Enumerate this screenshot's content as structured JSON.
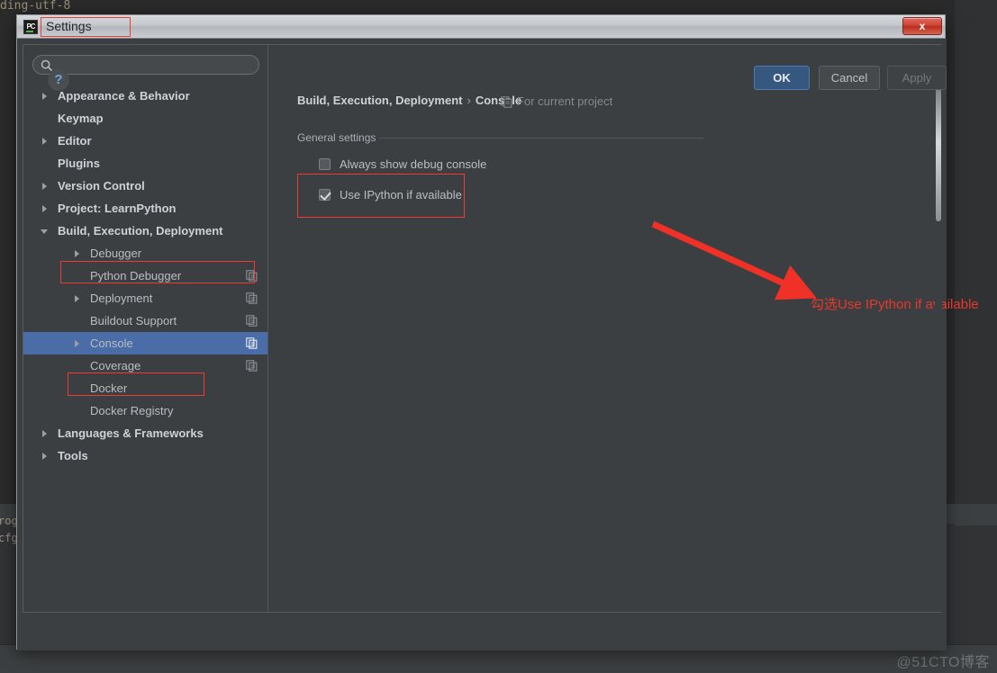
{
  "window": {
    "title": "Settings",
    "app_icon": "pycharm-icon",
    "close_label": "x"
  },
  "background": {
    "code_fragments": [
      "ding-utf-8",
      "rog",
      "cfg"
    ],
    "watermark": "@51CTO博客"
  },
  "sidebar": {
    "search": {
      "value": "",
      "placeholder": "",
      "icon": "search-icon"
    },
    "items": [
      {
        "label": "Appearance & Behavior",
        "level": 0,
        "arrow": "collapsed",
        "scope_icon": false,
        "selected": false
      },
      {
        "label": "Keymap",
        "level": 0,
        "arrow": "none",
        "scope_icon": false,
        "selected": false
      },
      {
        "label": "Editor",
        "level": 0,
        "arrow": "collapsed",
        "scope_icon": false,
        "selected": false
      },
      {
        "label": "Plugins",
        "level": 0,
        "arrow": "none",
        "scope_icon": false,
        "selected": false
      },
      {
        "label": "Version Control",
        "level": 0,
        "arrow": "collapsed",
        "scope_icon": false,
        "selected": false
      },
      {
        "label": "Project: LearnPython",
        "level": 0,
        "arrow": "collapsed",
        "scope_icon": false,
        "selected": false
      },
      {
        "label": "Build, Execution, Deployment",
        "level": 0,
        "arrow": "expanded",
        "scope_icon": false,
        "selected": false
      },
      {
        "label": "Debugger",
        "level": 1,
        "arrow": "collapsed",
        "scope_icon": false,
        "selected": false
      },
      {
        "label": "Python Debugger",
        "level": 1,
        "arrow": "none",
        "scope_icon": true,
        "selected": false
      },
      {
        "label": "Deployment",
        "level": 1,
        "arrow": "collapsed",
        "scope_icon": true,
        "selected": false
      },
      {
        "label": "Buildout Support",
        "level": 1,
        "arrow": "none",
        "scope_icon": true,
        "selected": false
      },
      {
        "label": "Console",
        "level": 1,
        "arrow": "collapsed",
        "scope_icon": true,
        "selected": true
      },
      {
        "label": "Coverage",
        "level": 1,
        "arrow": "none",
        "scope_icon": true,
        "selected": false
      },
      {
        "label": "Docker",
        "level": 1,
        "arrow": "none",
        "scope_icon": false,
        "selected": false
      },
      {
        "label": "Docker Registry",
        "level": 1,
        "arrow": "none",
        "scope_icon": false,
        "selected": false
      },
      {
        "label": "Languages & Frameworks",
        "level": 0,
        "arrow": "collapsed",
        "scope_icon": false,
        "selected": false
      },
      {
        "label": "Tools",
        "level": 0,
        "arrow": "collapsed",
        "scope_icon": false,
        "selected": false
      }
    ]
  },
  "main": {
    "breadcrumb_parent": "Build, Execution, Deployment",
    "breadcrumb_separator": "›",
    "breadcrumb_current": "Console",
    "scope_note": "For current project",
    "group_title": "General settings",
    "checkboxes": [
      {
        "label": "Always show debug console",
        "checked": false
      },
      {
        "label": "Use IPython if available",
        "checked": true
      }
    ]
  },
  "annotations": {
    "color": "#ee3b33",
    "text": "勾选Use IPython if available"
  },
  "footer": {
    "help_label": "?",
    "ok_label": "OK",
    "cancel_label": "Cancel",
    "apply_label": "Apply"
  }
}
